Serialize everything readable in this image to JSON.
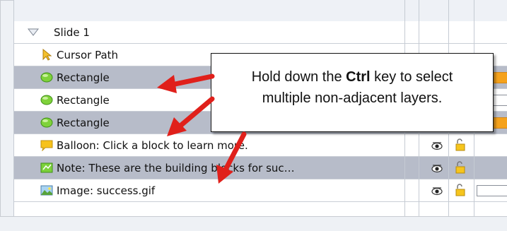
{
  "slide": {
    "name": "Slide 1"
  },
  "layers": [
    {
      "label": "Cursor Path",
      "icon": "cursor-path-icon",
      "selected": false,
      "eye": false,
      "lock": false,
      "timeline": "none"
    },
    {
      "label": "Rectangle",
      "icon": "rectangle-green-icon",
      "selected": true,
      "eye": false,
      "lock": false,
      "timeline": "orange"
    },
    {
      "label": "Rectangle",
      "icon": "rectangle-green-icon",
      "selected": false,
      "eye": false,
      "lock": false,
      "timeline": "white"
    },
    {
      "label": "Rectangle",
      "icon": "rectangle-green-icon",
      "selected": true,
      "eye": true,
      "lock": true,
      "timeline": "orange"
    },
    {
      "label": "Balloon: Click a block to learn more.",
      "icon": "balloon-icon",
      "selected": false,
      "eye": true,
      "lock": true,
      "timeline": "none"
    },
    {
      "label": "Note: These are the building blocks for suc…",
      "icon": "note-icon",
      "selected": true,
      "eye": true,
      "lock": true,
      "timeline": "none"
    },
    {
      "label": "Image: success.gif",
      "icon": "image-icon",
      "selected": false,
      "eye": true,
      "lock": true,
      "timeline": "white"
    }
  ],
  "callout": {
    "line1_before": "Hold down the ",
    "key": "Ctrl",
    "line1_after": " key to select",
    "line2": "multiple non-adjacent layers."
  },
  "colors": {
    "selected_row": "#b7bcc9",
    "arrow": "#e0201b",
    "timeline_orange": "#f5a21c"
  }
}
